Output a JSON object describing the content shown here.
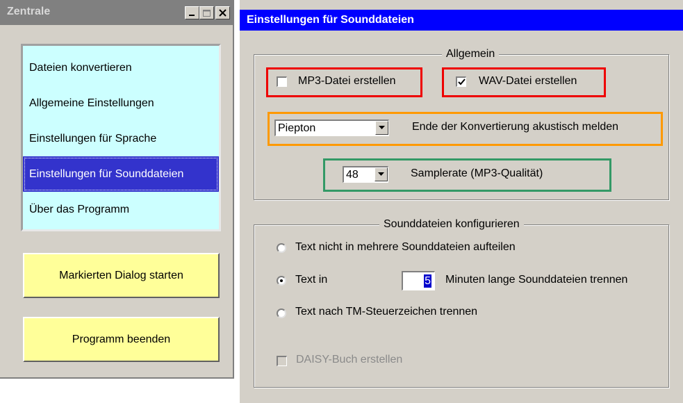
{
  "left_window": {
    "title": "Zentrale",
    "menu_items": [
      "Dateien konvertieren",
      "Allgemeine Einstellungen",
      "Einstellungen für Sprache",
      "Einstellungen für Sounddateien",
      "Über das Programm"
    ],
    "selected_index": 3,
    "start_button": "Markierten Dialog starten",
    "exit_button": "Programm beenden"
  },
  "right_window": {
    "title": "Einstellungen für Sounddateien",
    "general": {
      "legend": "Allgemein",
      "mp3_label": "MP3-Datei erstellen",
      "mp3_checked": false,
      "wav_label": "WAV-Datei erstellen",
      "wav_checked": true,
      "sound_select_value": "Piepton",
      "sound_label": "Ende der Konvertierung akustisch melden",
      "samplerate_value": "48",
      "samplerate_label": "Samplerate (MP3-Qualität)"
    },
    "configure": {
      "legend": "Sounddateien konfigurieren",
      "option1": "Text nicht in mehrere Sounddateien aufteilen",
      "option2_prefix": "Text in",
      "minutes_value": "5",
      "option2_suffix": "Minuten lange Sounddateien trennen",
      "option3": "Text nach TM-Steuerzeichen trennen",
      "selected_option": 2,
      "daisy_label": "DAISY-Buch erstellen",
      "daisy_checked": false
    }
  },
  "colors": {
    "face": "#d4d0c8",
    "menu_bg": "#ccffff",
    "menu_selected": "#3333cc",
    "button_yellow": "#ffff99",
    "active_title": "#0000ff",
    "inactive_title": "#808080",
    "highlight_red": "#ee0000",
    "highlight_orange": "#ff9900",
    "highlight_green": "#339966"
  }
}
